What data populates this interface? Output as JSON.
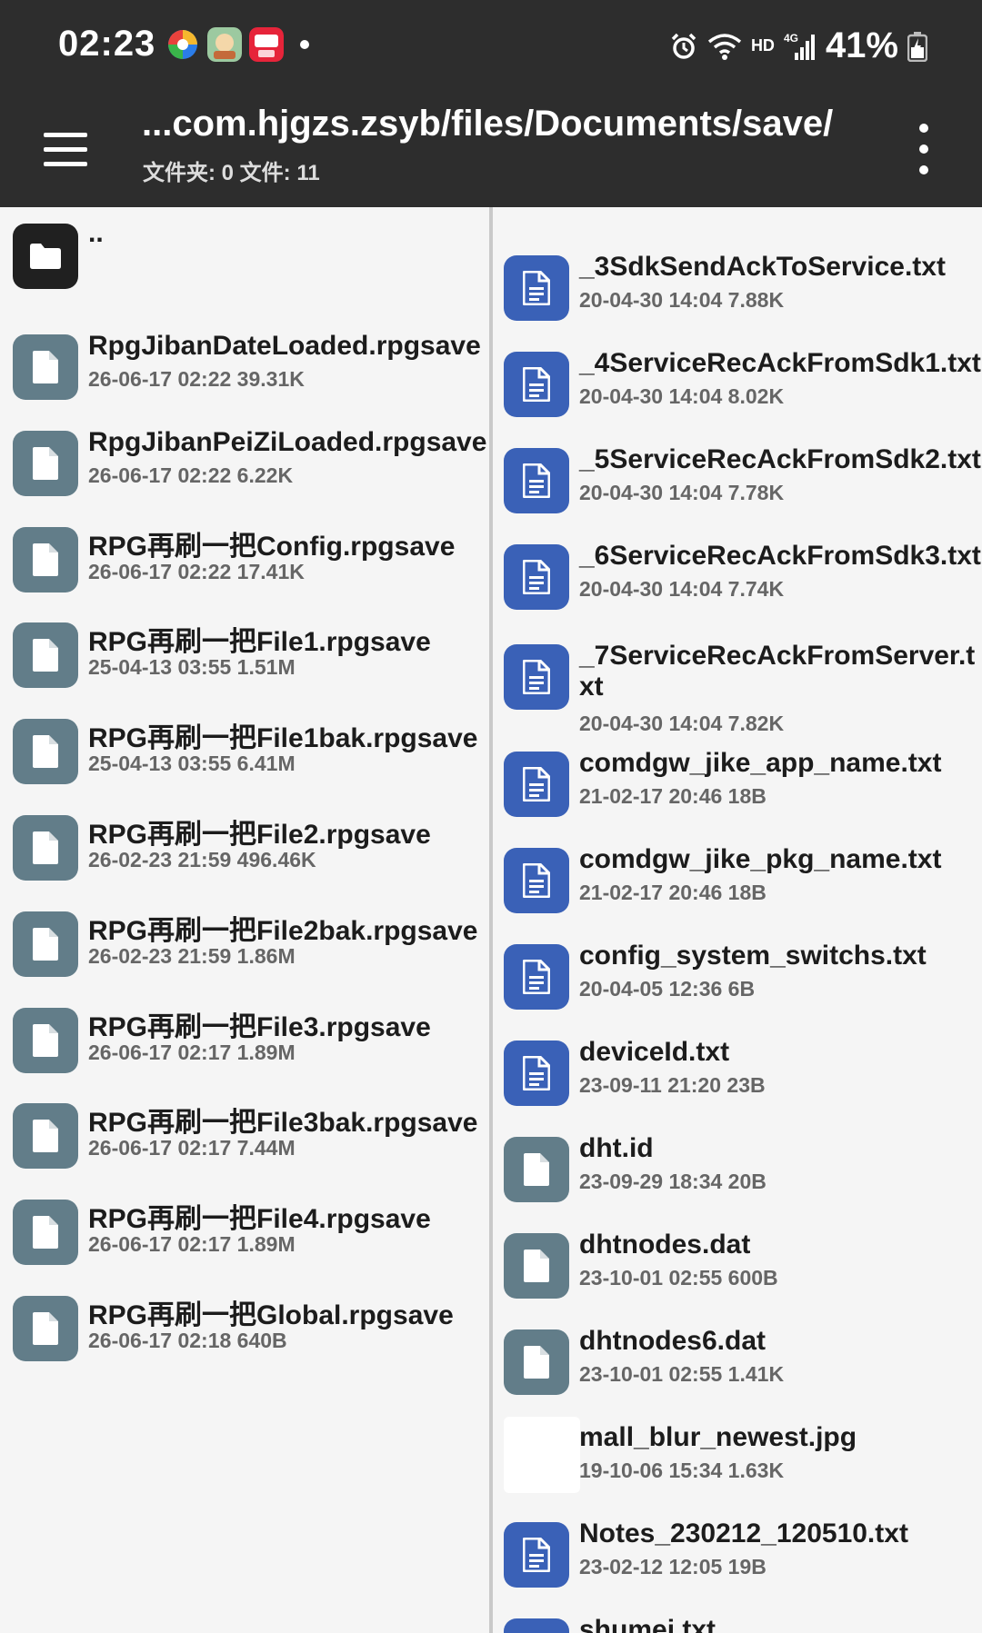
{
  "status_bar": {
    "time": "02:23",
    "network_type": "HD",
    "signal_label": "4G",
    "battery": "41%"
  },
  "app_bar": {
    "path": "...com.hjgzs.zsyb/files/Documents/save/",
    "counts": "文件夹: 0  文件: 11"
  },
  "left_pane": {
    "parent": "..",
    "items": [
      {
        "name": "RpgJibanDateLoaded.rpgsave",
        "meta": "26-06-17 02:22  39.31K"
      },
      {
        "name": "RpgJibanPeiZiLoaded.rpgsave",
        "meta": "26-06-17 02:22  6.22K"
      },
      {
        "name": "RPG再刷一把Config.rpgsave",
        "meta": "26-06-17 02:22  17.41K"
      },
      {
        "name": "RPG再刷一把File1.rpgsave",
        "meta": "25-04-13 03:55  1.51M"
      },
      {
        "name": "RPG再刷一把File1bak.rpgsave",
        "meta": "25-04-13 03:55  6.41M"
      },
      {
        "name": "RPG再刷一把File2.rpgsave",
        "meta": "26-02-23 21:59  496.46K"
      },
      {
        "name": "RPG再刷一把File2bak.rpgsave",
        "meta": "26-02-23 21:59  1.86M"
      },
      {
        "name": "RPG再刷一把File3.rpgsave",
        "meta": "26-06-17 02:17  1.89M"
      },
      {
        "name": "RPG再刷一把File3bak.rpgsave",
        "meta": "26-06-17 02:17  7.44M"
      },
      {
        "name": "RPG再刷一把File4.rpgsave",
        "meta": "26-06-17 02:17  1.89M"
      },
      {
        "name": "RPG再刷一把Global.rpgsave",
        "meta": "26-06-17 02:18  640B"
      }
    ]
  },
  "right_pane": {
    "items": [
      {
        "name": "_3SdkSendAckToService.txt",
        "meta": "20-04-30 14:04  7.88K",
        "kind": "doc"
      },
      {
        "name": "_4ServiceRecAckFromSdk1.txt",
        "meta": "20-04-30 14:04  8.02K",
        "kind": "doc"
      },
      {
        "name": "_5ServiceRecAckFromSdk2.txt",
        "meta": "20-04-30 14:04  7.78K",
        "kind": "doc"
      },
      {
        "name": "_6ServiceRecAckFromSdk3.txt",
        "meta": "20-04-30 14:04  7.74K",
        "kind": "doc"
      },
      {
        "name": "_7ServiceRecAckFromServer.txt",
        "meta": "20-04-30 14:04  7.82K",
        "kind": "doc"
      },
      {
        "name": "comdgw_jike_app_name.txt",
        "meta": "21-02-17 20:46  18B",
        "kind": "doc"
      },
      {
        "name": "comdgw_jike_pkg_name.txt",
        "meta": "21-02-17 20:46  18B",
        "kind": "doc"
      },
      {
        "name": "config_system_switchs.txt",
        "meta": "20-04-05 12:36  6B",
        "kind": "doc"
      },
      {
        "name": "deviceId.txt",
        "meta": "23-09-11 21:20  23B",
        "kind": "doc"
      },
      {
        "name": "dht.id",
        "meta": "23-09-29 18:34  20B",
        "kind": "file"
      },
      {
        "name": "dhtnodes.dat",
        "meta": "23-10-01 02:55  600B",
        "kind": "file"
      },
      {
        "name": "dhtnodes6.dat",
        "meta": "23-10-01 02:55  1.41K",
        "kind": "file"
      },
      {
        "name": "mall_blur_newest.jpg",
        "meta": "19-10-06 15:34  1.63K",
        "kind": "image"
      },
      {
        "name": "Notes_230212_120510.txt",
        "meta": "23-02-12 12:05  19B",
        "kind": "doc"
      },
      {
        "name": "shumei.txt",
        "meta": "",
        "kind": "doc"
      }
    ]
  },
  "colors": {
    "bar_bg": "#2d2d2d",
    "pane_bg": "#f5f5f5",
    "file_icon": "#627d89",
    "doc_icon": "#3a61b7"
  }
}
